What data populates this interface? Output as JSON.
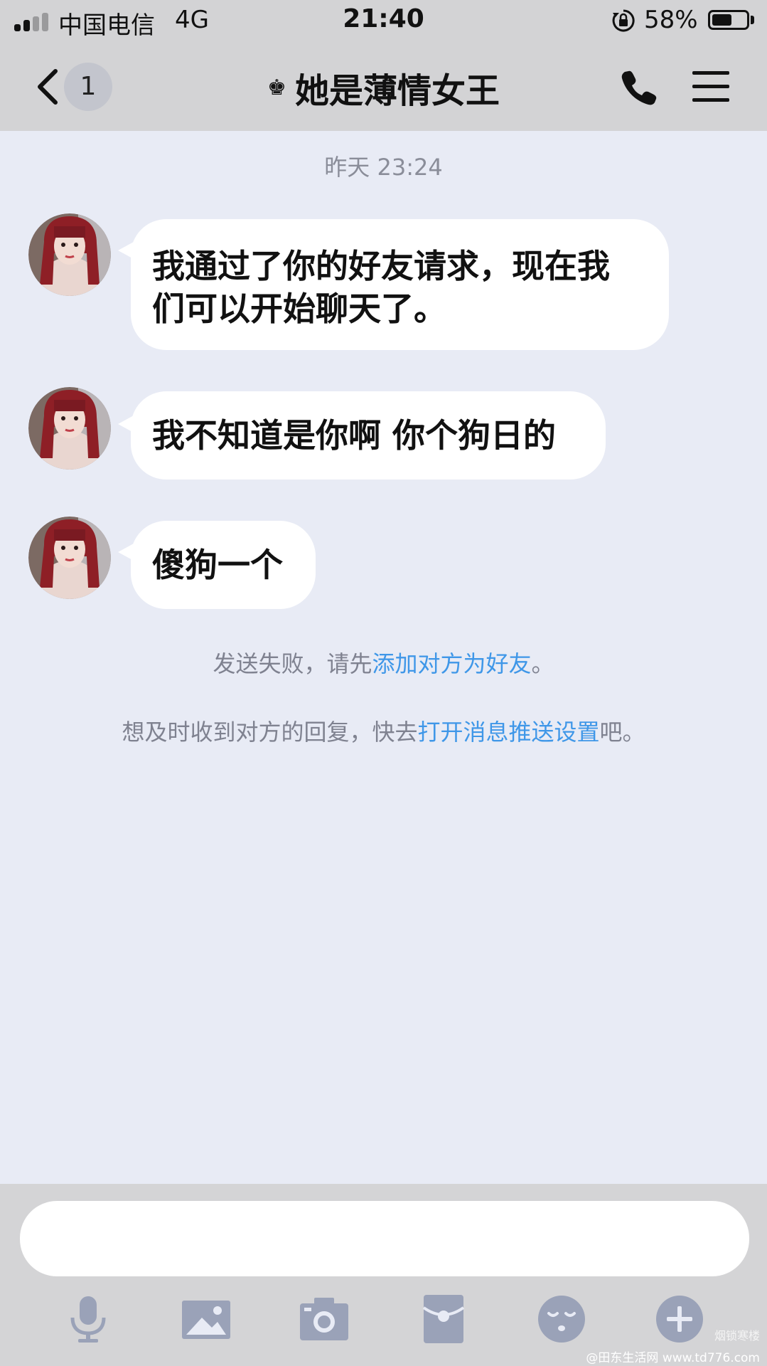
{
  "status_bar": {
    "carrier": "中国电信",
    "network": "4G",
    "time": "21:40",
    "battery_percent": "58%",
    "battery_level": 0.58
  },
  "header": {
    "back_badge": "1",
    "crown_icon": "♚",
    "title": "她是薄情女王"
  },
  "chat": {
    "timestamp": "昨天 23:24",
    "messages": [
      {
        "line1": "我通过了你的好友请求，现在我",
        "line2": "们可以开始聊天了。"
      },
      {
        "text": "我不知道是你啊 你个狗日的"
      },
      {
        "text": "傻狗一个"
      }
    ],
    "notices": {
      "send_failed": {
        "before": "发送失败，请先",
        "link": "添加对方为好友",
        "after": "。"
      },
      "push": {
        "before": "想及时收到对方的回复，快去",
        "link": "打开消息推送设置",
        "after": "吧。"
      }
    }
  },
  "input": {
    "placeholder": ""
  },
  "toolbar": [
    "mic-icon",
    "image-icon",
    "camera-icon",
    "red-packet-icon",
    "emoji-icon",
    "plus-icon"
  ],
  "watermark": {
    "line1": "烟锁寒楼",
    "line2": "@田东生活网 www.td776.com"
  },
  "colors": {
    "link": "#3f97e8",
    "chat_bg": "#e8ebf5",
    "bar_bg": "#d3d3d5",
    "icon_gray": "#9aa2b8"
  }
}
